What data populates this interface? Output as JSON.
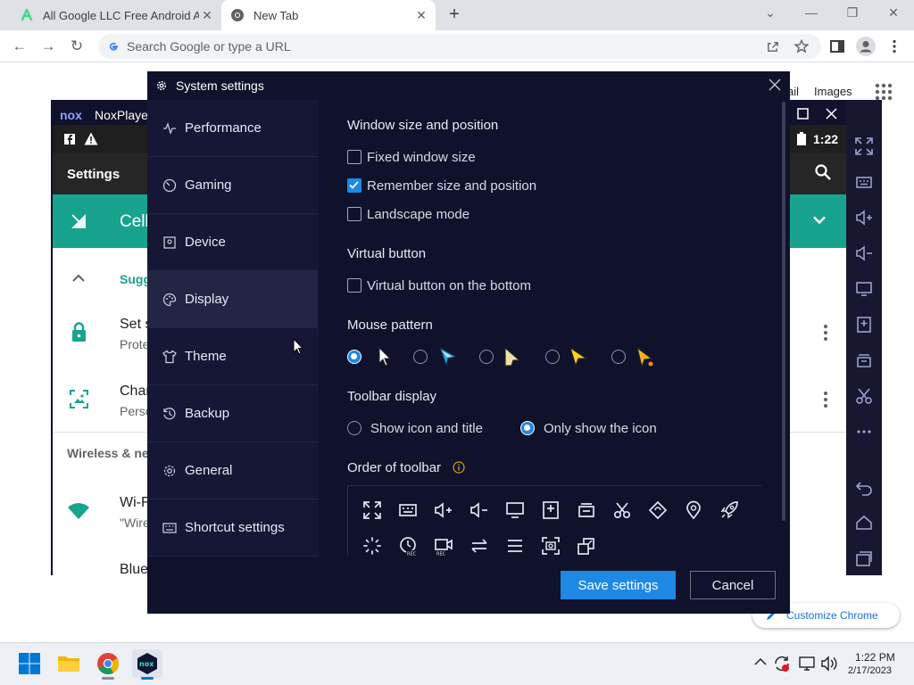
{
  "browser": {
    "tabs": [
      {
        "title": "All Google LLC Free Android App"
      },
      {
        "title": "New Tab"
      }
    ],
    "omnibox_placeholder": "Search Google or type a URL"
  },
  "google_page": {
    "gmail": "ail",
    "images": "Images",
    "customize": "Customize Chrome"
  },
  "nox": {
    "title": "NoxPlaye",
    "logo": "nox",
    "android": {
      "time": "1:22",
      "settings_title": "Settings",
      "cell_label": "Cell",
      "sugg_label": "Sugg",
      "row1_title": "Set s",
      "row1_sub": "Prote",
      "row2_title": "Char",
      "row2_sub": "Perso",
      "section": "Wireless & net",
      "wifi_title": "Wi-F",
      "wifi_sub": "\"Wire",
      "bt_title": "Blue"
    }
  },
  "dialog": {
    "title": "System settings",
    "sidebar": [
      {
        "label": "Performance",
        "icon": "pulse-icon"
      },
      {
        "label": "Gaming",
        "icon": "gauge-icon"
      },
      {
        "label": "Device",
        "icon": "device-icon"
      },
      {
        "label": "Display",
        "icon": "palette-icon"
      },
      {
        "label": "Theme",
        "icon": "shirt-icon"
      },
      {
        "label": "Backup",
        "icon": "history-icon"
      },
      {
        "label": "General",
        "icon": "gear-icon"
      },
      {
        "label": "Shortcut settings",
        "icon": "keyboard-icon"
      }
    ],
    "window_section": "Window size and position",
    "fixed_size": "Fixed window size",
    "remember": "Remember size and position",
    "landscape": "Landscape mode",
    "virtual_section": "Virtual button",
    "virtual_bottom": "Virtual button on the bottom",
    "mouse_section": "Mouse pattern",
    "toolbar_section": "Toolbar display",
    "show_icon_title": "Show icon and title",
    "only_icon": "Only show the icon",
    "order_section": "Order of toolbar",
    "save": "Save settings",
    "cancel": "Cancel"
  },
  "taskbar": {
    "time": "1:22 PM",
    "date": "2/17/2023"
  },
  "colors": {
    "dialog_bg": "#10122b",
    "accent": "#1e88e5",
    "teal": "#18a38e"
  }
}
